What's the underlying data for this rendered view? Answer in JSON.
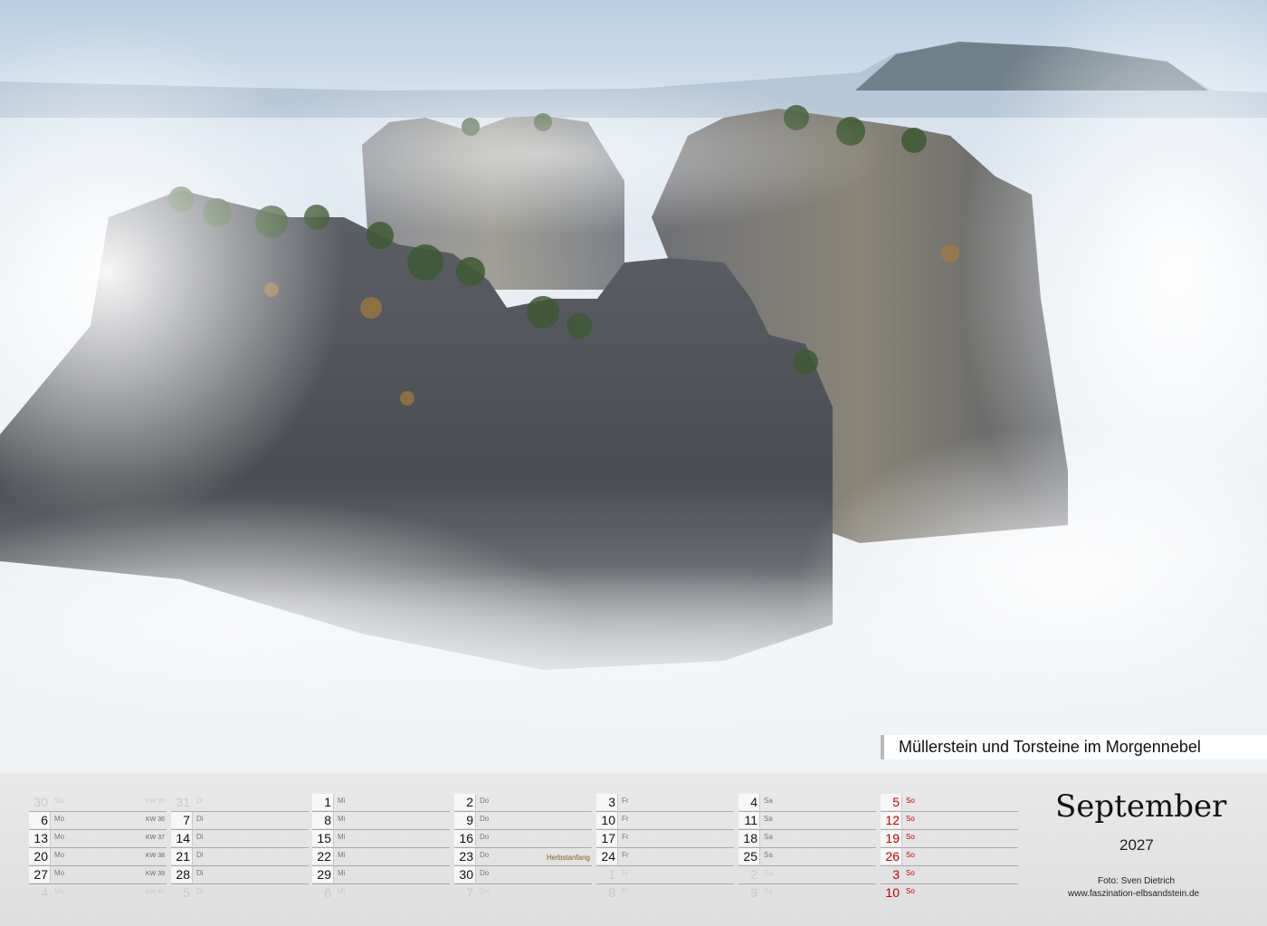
{
  "caption": "Müllerstein und Torsteine im Morgennebel",
  "month": "September",
  "year": "2027",
  "credit_photo": "Foto: Sven Dietrich",
  "credit_url": "www.faszination-elbsandstein.de",
  "columns": [
    {
      "rows": [
        {
          "num": "30",
          "wd": "So",
          "kw": "KW 35",
          "dim": true
        },
        {
          "num": "6",
          "wd": "Mo",
          "kw": "KW 36"
        },
        {
          "num": "13",
          "wd": "Mo",
          "kw": "KW 37"
        },
        {
          "num": "20",
          "wd": "Mo",
          "kw": "KW 38"
        },
        {
          "num": "27",
          "wd": "Mo",
          "kw": "KW 39"
        },
        {
          "num": "4",
          "wd": "Mo",
          "kw": "KW 40",
          "dim": true
        }
      ]
    },
    {
      "rows": [
        {
          "num": "31",
          "wd": "Di",
          "dim": true
        },
        {
          "num": "7",
          "wd": "Di"
        },
        {
          "num": "14",
          "wd": "Di"
        },
        {
          "num": "21",
          "wd": "Di"
        },
        {
          "num": "28",
          "wd": "Di"
        },
        {
          "num": "5",
          "wd": "Di",
          "dim": true
        }
      ]
    },
    {
      "rows": [
        {
          "num": "1",
          "wd": "Mi"
        },
        {
          "num": "8",
          "wd": "Mi"
        },
        {
          "num": "15",
          "wd": "Mi"
        },
        {
          "num": "22",
          "wd": "Mi"
        },
        {
          "num": "29",
          "wd": "Mi"
        },
        {
          "num": "6",
          "wd": "Mi",
          "dim": true
        }
      ]
    },
    {
      "rows": [
        {
          "num": "2",
          "wd": "Do"
        },
        {
          "num": "9",
          "wd": "Do"
        },
        {
          "num": "16",
          "wd": "Do"
        },
        {
          "num": "23",
          "wd": "Do",
          "note": "Herbstanfang"
        },
        {
          "num": "30",
          "wd": "Do"
        },
        {
          "num": "7",
          "wd": "Do",
          "dim": true
        }
      ]
    },
    {
      "rows": [
        {
          "num": "3",
          "wd": "Fr"
        },
        {
          "num": "10",
          "wd": "Fr"
        },
        {
          "num": "17",
          "wd": "Fr"
        },
        {
          "num": "24",
          "wd": "Fr"
        },
        {
          "num": "1",
          "wd": "Fr",
          "dim": true
        },
        {
          "num": "8",
          "wd": "Fr",
          "dim": true
        }
      ]
    },
    {
      "rows": [
        {
          "num": "4",
          "wd": "Sa"
        },
        {
          "num": "11",
          "wd": "Sa"
        },
        {
          "num": "18",
          "wd": "Sa"
        },
        {
          "num": "25",
          "wd": "Sa"
        },
        {
          "num": "2",
          "wd": "Sa",
          "dim": true
        },
        {
          "num": "9",
          "wd": "Sa",
          "dim": true
        }
      ]
    },
    {
      "sunday": true,
      "rows": [
        {
          "num": "5",
          "wd": "So"
        },
        {
          "num": "12",
          "wd": "So"
        },
        {
          "num": "19",
          "wd": "So"
        },
        {
          "num": "26",
          "wd": "So"
        },
        {
          "num": "3",
          "wd": "So",
          "dim": true
        },
        {
          "num": "10",
          "wd": "So",
          "dim": true
        }
      ]
    }
  ]
}
